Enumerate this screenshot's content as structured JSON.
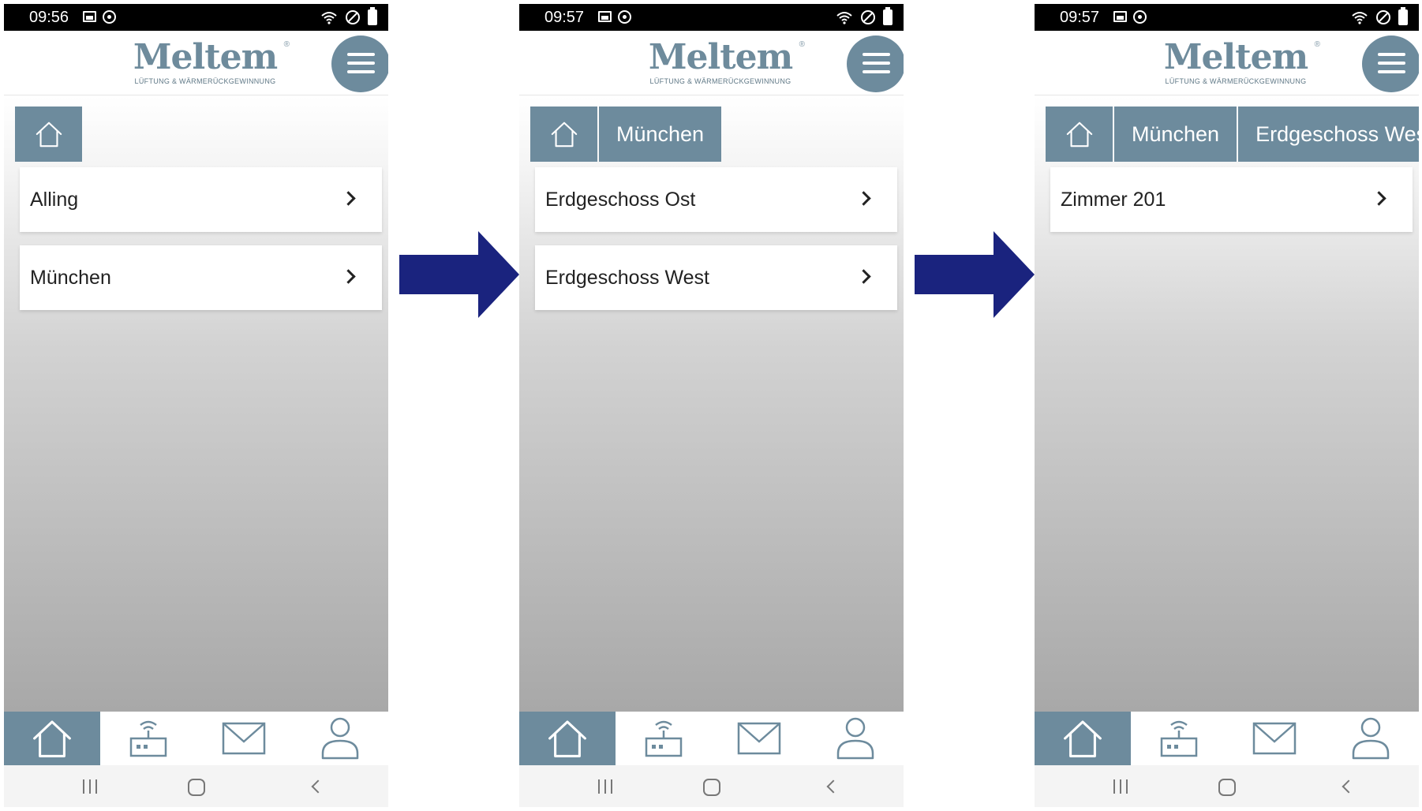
{
  "theme": {
    "accent": "#6d8b9d",
    "arrow": "#1a237e",
    "statusbar": "#000000"
  },
  "brand": {
    "logo_text": "Meltem",
    "logo_registered": "®",
    "tagline": "LÜFTUNG & WÄRMERÜCKGEWINNUNG"
  },
  "screens": [
    {
      "status_time": "09:56",
      "breadcrumbs": [],
      "items": [
        {
          "label": "Alling"
        },
        {
          "label": "München"
        }
      ]
    },
    {
      "status_time": "09:57",
      "breadcrumbs": [
        {
          "label": "München"
        }
      ],
      "items": [
        {
          "label": "Erdgeschoss Ost"
        },
        {
          "label": "Erdgeschoss West"
        }
      ]
    },
    {
      "status_time": "09:57",
      "breadcrumbs": [
        {
          "label": "München"
        },
        {
          "label": "Erdgeschoss West"
        }
      ],
      "items": [
        {
          "label": "Zimmer 201"
        }
      ]
    }
  ],
  "bottom_nav": [
    {
      "icon": "home-icon",
      "active": true
    },
    {
      "icon": "device-icon",
      "active": false
    },
    {
      "icon": "mail-icon",
      "active": false
    },
    {
      "icon": "user-icon",
      "active": false
    }
  ],
  "system_nav": [
    "recent-apps-icon",
    "system-home-icon",
    "back-icon"
  ],
  "flow_arrows": 2
}
